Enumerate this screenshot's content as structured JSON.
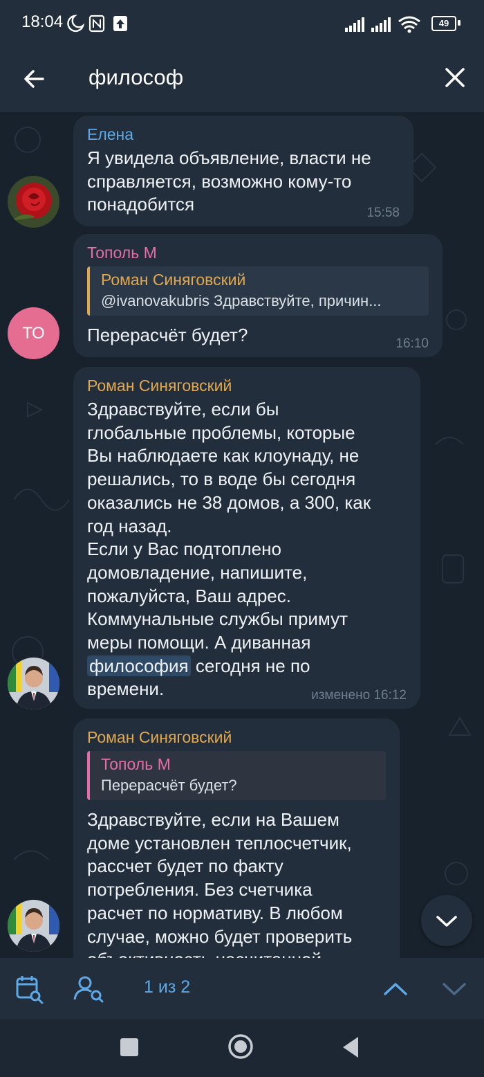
{
  "status_bar": {
    "time": "18:04",
    "battery": "49"
  },
  "search": {
    "query": "философ"
  },
  "messages": [
    {
      "sender": "Елена",
      "sender_color": "#5eaae8",
      "lines": [
        "Я увидела объявление, власти не",
        "справляется, возможно кому-то",
        "понадобится"
      ],
      "time": "15:58"
    },
    {
      "sender": "Тополь М",
      "sender_color": "#e56da8",
      "avatar_initials": "ТО",
      "reply": {
        "name": "Роман Синяговский",
        "text": "@ivanovakubris Здравствуйте, причин..."
      },
      "lines": [
        "Перерасчёт будет?"
      ],
      "time": "16:10"
    },
    {
      "sender": "Роман Синяговский",
      "sender_color": "#e2a84f",
      "lines_before": [
        "Здравствуйте, если бы",
        "глобальные проблемы, которые",
        "Вы наблюдаете как клоунаду, не",
        "решались, то в воде бы сегодня",
        "оказались не 38 домов, а 300, как",
        "год назад.",
        "Если у Вас подтоплено",
        "домовладение, напишите,",
        "пожалуйста, Ваш адрес.",
        "Коммунальные службы примут",
        "меры помощи.  А диванная"
      ],
      "highlight": "философия",
      "highlight_rest": " сегодня не по",
      "lines_after": [
        "времени."
      ],
      "time": "изменено 16:12"
    },
    {
      "sender": "Роман Синяговский",
      "sender_color": "#e2a84f",
      "reply": {
        "name": "Тополь М",
        "text": "Перерасчёт будет?"
      },
      "lines": [
        "Здравствуйте, если на Вашем",
        "доме установлен теплосчетчик,",
        "рассчет будет по факту",
        "потребления. Без счетчика",
        "расчет по нормативу. В любом",
        "случае, можно будет проверить",
        "объективность насчитанной"
      ]
    }
  ],
  "search_nav": {
    "counter": "1 из 2"
  },
  "icons": {
    "back": "arrow-left-icon",
    "close": "close-icon",
    "calendar": "calendar-search-icon",
    "user": "user-search-icon",
    "up": "chevron-up-icon",
    "down": "chevron-down-icon"
  },
  "colors": {
    "accent": "#5eaae8",
    "bubble": "#232e3c",
    "background": "#18222d"
  }
}
